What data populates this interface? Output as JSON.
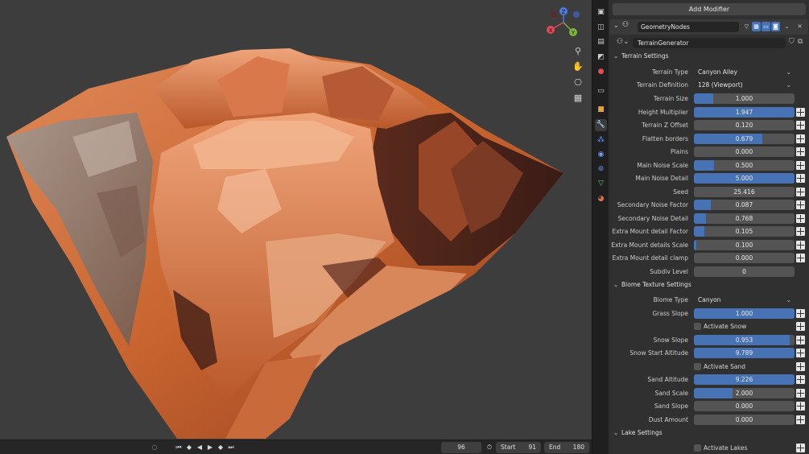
{
  "timeline": {
    "current_frame": "96",
    "start_label": "Start",
    "start_value": "91",
    "end_label": "End",
    "end_value": "180"
  },
  "gizmo": {
    "x": "X",
    "y": "Y",
    "z": "Z"
  },
  "panel": {
    "add_modifier": "Add Modifier",
    "modifier_name": "GeometryNodes",
    "node_group": "TerrainGenerator"
  },
  "sections": {
    "terrain": "Terrain Settings",
    "biome": "Biome Texture Settings",
    "lake": "Lake Settings"
  },
  "terrain_settings": {
    "terrain_type": {
      "label": "Terrain Type",
      "value": "Canyon Alley"
    },
    "terrain_definition": {
      "label": "Terrain Definition",
      "value": "128 (Viewport)"
    },
    "sliders": [
      {
        "label": "Terrain Size",
        "value": "1.000",
        "fill": 0.19,
        "input": false
      },
      {
        "label": "Height Multiplier",
        "value": "1.947",
        "fill": 1.0,
        "input": true
      },
      {
        "label": "Terrain Z Offset",
        "value": "0.120",
        "fill": 0.0,
        "input": true
      },
      {
        "label": "Flatten borders",
        "value": "0.679",
        "fill": 0.68,
        "input": true
      },
      {
        "label": "Plains",
        "value": "0.000",
        "fill": 0.0,
        "input": true
      },
      {
        "label": "Main Noise Scale",
        "value": "0.500",
        "fill": 0.2,
        "input": true
      },
      {
        "label": "Main Noise Detail",
        "value": "5.000",
        "fill": 1.0,
        "input": true
      },
      {
        "label": "Seed",
        "value": "25.416",
        "fill": 0.0,
        "input": true
      },
      {
        "label": "Secondary Noise Factor",
        "value": "0.087",
        "fill": 0.17,
        "input": true
      },
      {
        "label": "Secondary Noise Detail",
        "value": "0.768",
        "fill": 0.12,
        "input": true
      },
      {
        "label": "Extra Mount detail Factor",
        "value": "0.105",
        "fill": 0.1,
        "input": true
      },
      {
        "label": "Extra Mount details Scale",
        "value": "0.100",
        "fill": 0.02,
        "input": true
      },
      {
        "label": "Extra Mount detail clamp",
        "value": "0.000",
        "fill": 0.0,
        "input": true
      },
      {
        "label": "Subdiv Level",
        "value": "0",
        "fill": 0.0,
        "input": false
      }
    ]
  },
  "biome_settings": {
    "biome_type": {
      "label": "Biome Type",
      "value": "Canyon"
    },
    "grass_slope": {
      "label": "Grass Slope",
      "value": "1.000",
      "fill": 1.0
    },
    "activate_snow": "Activate Snow",
    "snow_slope": {
      "label": "Snow Slope",
      "value": "0.953",
      "fill": 0.95
    },
    "snow_start_altitude": {
      "label": "Snow Start Altitude",
      "value": "9.789",
      "fill": 1.0
    },
    "activate_sand": "Activate Sand",
    "sand_altitude": {
      "label": "Sand Altitude",
      "value": "9.226",
      "fill": 1.0
    },
    "sand_scale": {
      "label": "Sand Scale",
      "value": "2.000",
      "fill": 0.38
    },
    "sand_slope": {
      "label": "Sand Slope",
      "value": "0.000",
      "fill": 0.0
    },
    "dust_amount": {
      "label": "Dust Amount",
      "value": "0.000",
      "fill": 0.0
    }
  },
  "lake_settings": {
    "activate_lakes": "Activate Lakes"
  }
}
